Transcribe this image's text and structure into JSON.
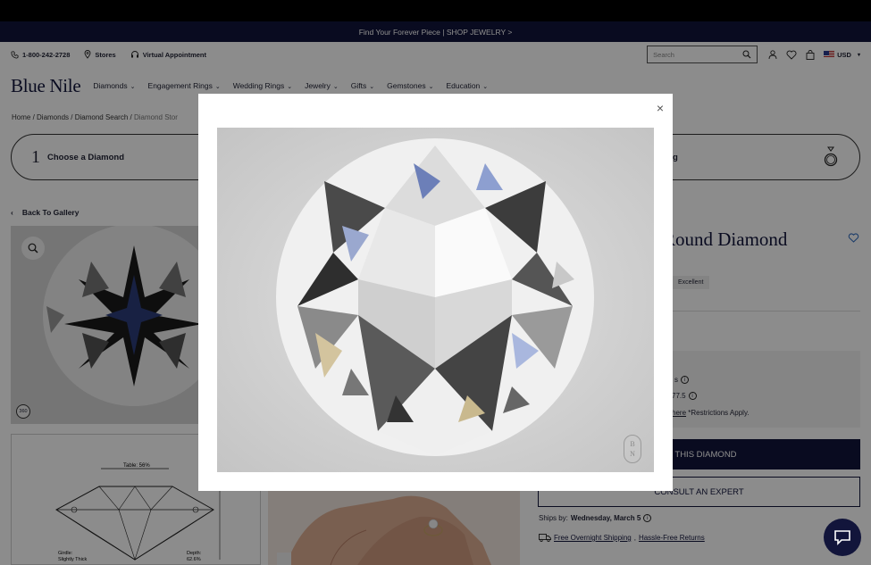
{
  "promo": {
    "text": "Find Your Forever Piece | SHOP JEWELRY >"
  },
  "utility": {
    "phone": "1-800-242-2728",
    "stores": "Stores",
    "virtual": "Virtual Appointment",
    "search_placeholder": "Search",
    "currency": "USD"
  },
  "nav": {
    "logo": "Blue Nile",
    "items": [
      {
        "label": "Diamonds"
      },
      {
        "label": "Engagement Rings"
      },
      {
        "label": "Wedding Rings"
      },
      {
        "label": "Jewelry"
      },
      {
        "label": "Gifts"
      },
      {
        "label": "Gemstones"
      },
      {
        "label": "Education"
      }
    ]
  },
  "breadcrumb": {
    "home": "Home",
    "diamonds": "Diamonds",
    "search": "Diamond Search",
    "current": "Diamond Stor"
  },
  "steps": {
    "step1_num": "1",
    "step1_label": "Choose a Diamond",
    "step3_label": "g"
  },
  "gallery": {
    "back": "Back To Gallery",
    "badge": "360"
  },
  "diagram": {
    "table": "Table: 56%",
    "girdle": "Girdle:",
    "girdle_val": "Slightly Thick",
    "depth": "Depth:",
    "depth_val": "62.6%"
  },
  "product": {
    "title": "Round Diamond",
    "tag": "Excellent",
    "price_line1": "s",
    "price_line2": "77.5",
    "restrict_link": "here",
    "restrict_text": "*Restrictions Apply.",
    "select": "CT THIS DIAMOND",
    "consult": "CONSULT AN EXPERT",
    "ships_label": "Ships by:",
    "ships_date": "Wednesday, March 5",
    "shipping1": "Free Overnight Shipping",
    "shipping_sep": ",",
    "shipping2": "Hassle-Free Returns"
  },
  "modal": {
    "close": "×",
    "watermark_top": "B",
    "watermark_bottom": "N"
  },
  "colors": {
    "navy": "#12153b",
    "promo": "#12153b"
  }
}
